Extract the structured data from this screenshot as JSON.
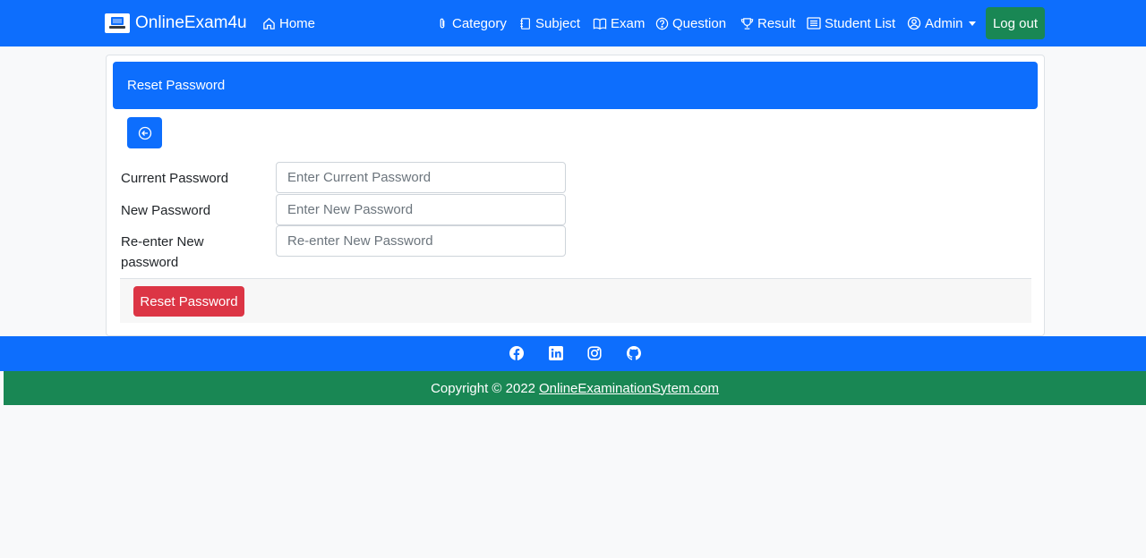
{
  "navbar": {
    "brand": "OnlineExam4u",
    "home": "Home",
    "category": "Category",
    "subject": "Subject",
    "exam": "Exam",
    "question": "Question",
    "result": "Result",
    "student_list": "Student List",
    "admin": "Admin",
    "logout": "Log out"
  },
  "card": {
    "header": "Reset Password",
    "fields": [
      {
        "label": "Current Password",
        "placeholder": "Enter Current Password",
        "value": ""
      },
      {
        "label": "New Password",
        "placeholder": "Enter New Password",
        "value": ""
      },
      {
        "label": "Re-enter New password",
        "placeholder": "Re-enter New Password",
        "value": ""
      }
    ],
    "submit": "Reset Password"
  },
  "footer": {
    "social": [
      "facebook-icon",
      "linkedin-icon",
      "instagram-icon",
      "github-icon"
    ],
    "copyright_prefix": "Copyright © 2022",
    "copyright_link": "OnlineExaminationSytem.com"
  },
  "colors": {
    "primary": "#0d6efd",
    "success": "#198754",
    "danger": "#dc3545",
    "page_bg": "#f8f9fa"
  }
}
